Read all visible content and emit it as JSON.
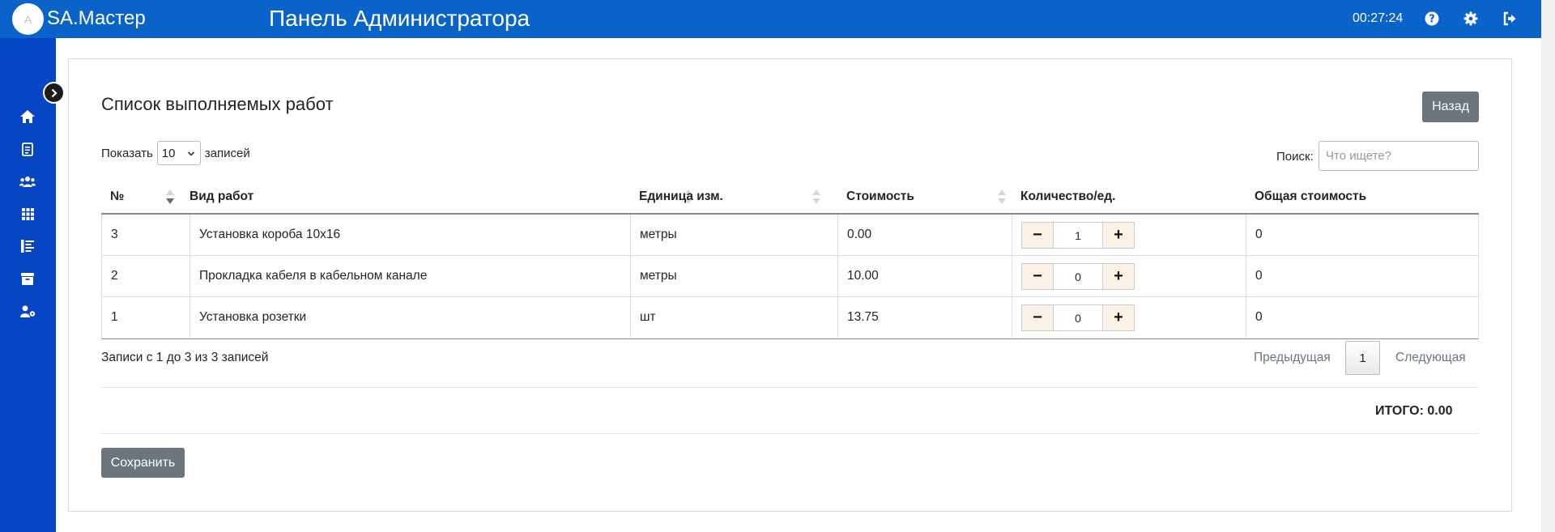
{
  "header": {
    "avatar_letter": "A",
    "brand": "SA.Мастер",
    "title": "Панель Администратора",
    "clock": "00:27:24",
    "icons": [
      "help-icon",
      "settings-gear-icon",
      "logout-icon"
    ]
  },
  "sidebar": {
    "items": [
      "home-icon",
      "document-icon",
      "users-icon",
      "grid-icon",
      "list-icon",
      "archive-icon",
      "user-settings-icon"
    ],
    "toggle_icon": "chevron-right-icon"
  },
  "card": {
    "title": "Список выполняемых работ",
    "back_button": "Назад",
    "length": {
      "prefix": "Показать",
      "value": "10",
      "suffix": "записей"
    },
    "search": {
      "label": "Поиск:",
      "placeholder": "Что ищете?"
    },
    "columns": [
      "№",
      "Вид работ",
      "Единица изм.",
      "Стоимость",
      "Количество/ед.",
      "Общая стоимость"
    ],
    "rows": [
      {
        "num": "3",
        "work": "Установка короба 10x16",
        "unit": "метры",
        "cost": "0.00",
        "qty": "1",
        "total": "0"
      },
      {
        "num": "2",
        "work": "Прокладка кабеля в кабельном канале",
        "unit": "метры",
        "cost": "10.00",
        "qty": "0",
        "total": "0"
      },
      {
        "num": "1",
        "work": "Установка розетки",
        "unit": "шт",
        "cost": "13.75",
        "qty": "0",
        "total": "0"
      }
    ],
    "qty_minus": "−",
    "qty_plus": "+",
    "info": "Записи с 1 до 3 из 3 записей",
    "pagination": {
      "prev": "Предыдущая",
      "current": "1",
      "next": "Следующая"
    },
    "total": "ИТОГО: 0.00",
    "save_button": "Сохранить"
  },
  "colors": {
    "topbar": "#0a63c8",
    "sidebar": "#0645c4",
    "button_gray": "#6c757d",
    "qty_button_bg": "#fbf1e4"
  }
}
